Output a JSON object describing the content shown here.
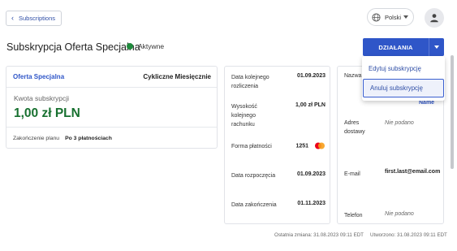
{
  "nav": {
    "back_label": "Subscriptions"
  },
  "lang": {
    "label": "Polski"
  },
  "header": {
    "title": "Subskrypcja Oferta Specjalna",
    "status": "Aktywne",
    "actions_label": "DZIAŁANIA"
  },
  "menu": {
    "items": [
      "Edytuj subskrypcję",
      "Anuluj subskrypcję"
    ]
  },
  "summary": {
    "plan_name": "Oferta Specjalna",
    "cycle": "Cykliczne Miesięcznie",
    "amount_label": "Kwota subskrypcji",
    "amount": "1,00 zł PLN",
    "end_label": "Zakończenie planu",
    "end_value": "Po 3 płatnościach"
  },
  "details": {
    "next_date_label": "Data kolejnego rozliczenia",
    "next_date": "01.09.2023",
    "next_amount_label": "Wysokość kolejnego rachunku",
    "next_amount": "1,00 zł PLN",
    "payment_label": "Forma płatności",
    "card_last4": "1251",
    "start_label": "Data rozpoczęcia",
    "start_date": "01.09.2023",
    "end_label": "Data zakończenia",
    "end_date": "01.11.2023"
  },
  "customer": {
    "name_label": "Nazwa",
    "name_value": "Name",
    "address_label": "Adres dostawy",
    "address_value": "Nie podano",
    "email_label": "E-mail",
    "email_value": "first.last@email.com",
    "phone_label": "Telefon",
    "phone_value": "Nie podano"
  },
  "footer": {
    "modified": "Ostatnia zmiana: 31.08.2023 09:11 EDT",
    "created": "Utworzono: 31.08.2023 09:11 EDT"
  },
  "colors": {
    "accent": "#2f56c8",
    "active": "#1f8a3c",
    "amount": "#17702f"
  },
  "icons": [
    "chevron-left-icon",
    "globe-icon",
    "chevron-down-icon",
    "user-icon",
    "mastercard-icon"
  ]
}
